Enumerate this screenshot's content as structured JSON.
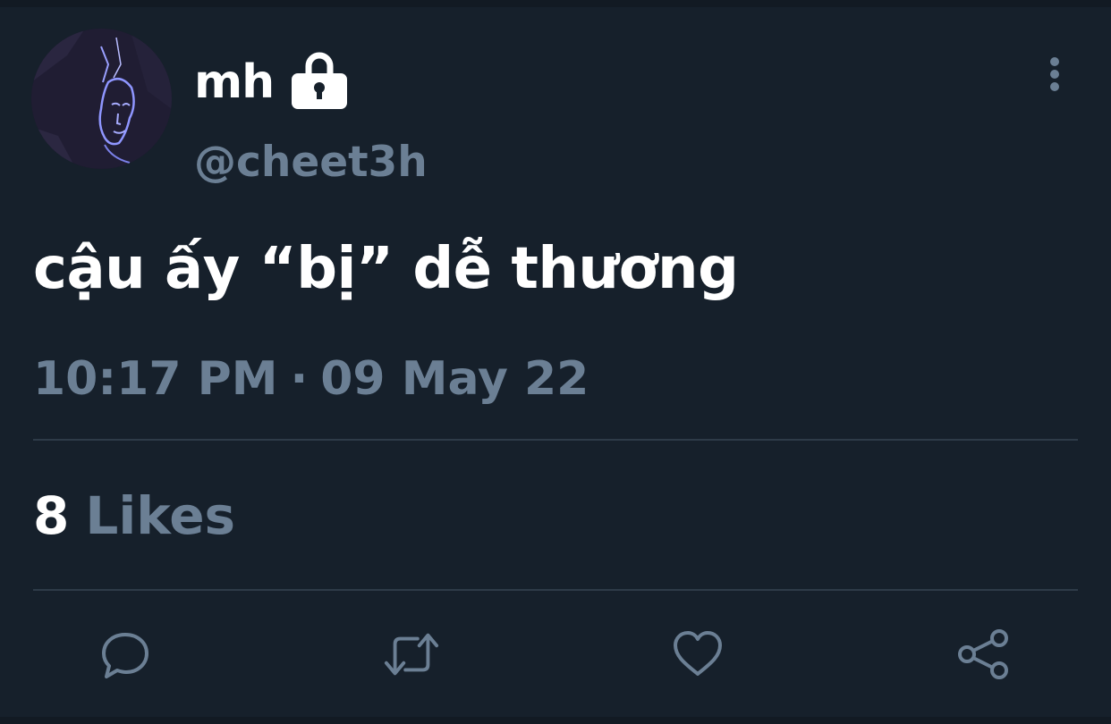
{
  "user": {
    "display_name": "mh",
    "handle": "@cheet3h",
    "protected_icon": "lock-icon"
  },
  "tweet": {
    "text": "cậu ấy “bị” dễ thương",
    "time": "10:17 PM",
    "separator": "·",
    "date": "09 May 22"
  },
  "stats": {
    "likes_count": "8",
    "likes_label": "Likes"
  },
  "actions": [
    {
      "name": "reply",
      "icon": "reply-icon"
    },
    {
      "name": "retweet",
      "icon": "retweet-icon"
    },
    {
      "name": "like",
      "icon": "heart-icon"
    },
    {
      "name": "share",
      "icon": "share-icon"
    }
  ],
  "colors": {
    "background": "#16202b",
    "primary_text": "#ffffff",
    "secondary_text": "#6b7f94",
    "divider": "#2e3b48"
  }
}
